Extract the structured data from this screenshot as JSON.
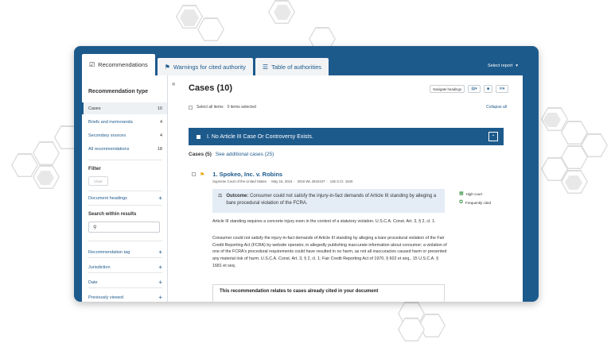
{
  "tabs": [
    {
      "label": "Recommendations",
      "icon": "checklist-icon",
      "active": true
    },
    {
      "label": "Warnings for cited authority",
      "icon": "flag-icon",
      "active": false
    },
    {
      "label": "Table of authorities",
      "icon": "list-icon",
      "active": false
    }
  ],
  "select_report": "Select report",
  "sidebar": {
    "title": "Recommendation type",
    "items": [
      {
        "label": "Cases",
        "count": "10"
      },
      {
        "label": "Briefs and memoranda",
        "count": "4"
      },
      {
        "label": "Secondary sources",
        "count": "4"
      },
      {
        "label": "All recommendations",
        "count": "18"
      }
    ],
    "filter_title": "Filter",
    "clear_label": "Clear",
    "document_headings": "Document headings",
    "search_label": "Search within results",
    "filters": [
      "Recommendation tag",
      "Jurisdiction",
      "Date",
      "Previously viewed"
    ]
  },
  "main": {
    "title": "Cases (10)",
    "navigate_headings": "Navigate headings",
    "select_all": "Select all items",
    "items_selected": "0 items selected",
    "collapse_all": "Collapse all",
    "section_heading": "I. No Article III Case Or Controversy Exists.",
    "cases_label": "Cases (5)",
    "see_additional": "See additional cases (25)",
    "case": {
      "number_title": "1.  Spokeo, Inc. v. Robins",
      "court": "Supreme Court of the United States",
      "date": "May 16, 2016",
      "citation_wl": "2016 WL 2842447",
      "citation_sct": "136 S.Ct. 1540",
      "outcome_label": "Outcome:",
      "outcome_text": "Consumer could not satisfy the injury-in-fact demands of Article III standing by alleging a bare procedural violation of the FCRA.",
      "badges": [
        "High court",
        "Frequently cited"
      ],
      "para1": "Article III standing requires a concrete injury even in the context of a statutory violation. U.S.C.A. Const. Art. 3, § 2, cl. 1.",
      "para2": "Consumer could not satisfy the injury-in-fact demands of Article III standing by alleging a bare procedural violation of the Fair Credit Reporting Act (FCRA) by website operator, in allegedly publishing inaccurate information about consumer; a violation of one of the FCRA's procedural requirements could have resulted in no harm, as not all inaccuracies caused harm or presented any material risk of harm. U.S.C.A. Const. Art. 3, § 2, cl. 1; Fair Credit Reporting Act of 1970, § 602 et seq., 15 U.S.C.A. § 1681 et seq.",
      "related_heading": "This recommendation relates to cases already cited in your document"
    }
  },
  "colors": {
    "brand": "#1d5a8c",
    "flag": "#e8a400",
    "green": "#2e8b3a",
    "outcome_bg": "#e4ecf6"
  }
}
